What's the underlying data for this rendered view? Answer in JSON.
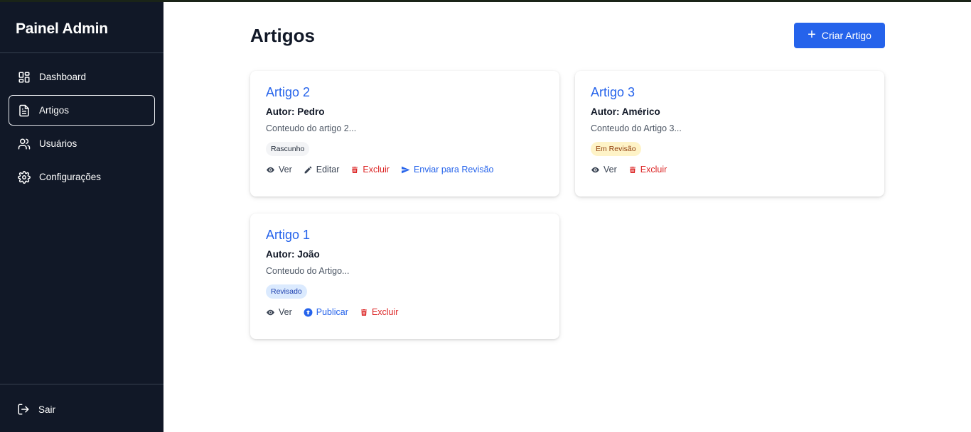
{
  "sidebar": {
    "brand": "Painel Admin",
    "items": [
      {
        "label": "Dashboard",
        "icon": "dashboard-icon"
      },
      {
        "label": "Artigos",
        "icon": "document-icon",
        "active": true
      },
      {
        "label": "Usuários",
        "icon": "users-icon"
      },
      {
        "label": "Configurações",
        "icon": "gear-icon"
      }
    ],
    "logout": "Sair"
  },
  "main": {
    "title": "Artigos",
    "create_button": "Criar Artigo",
    "articles": [
      {
        "title": "Artigo 2",
        "author": "Autor: Pedro",
        "excerpt": "Conteudo do artigo 2...",
        "status": "Rascunho",
        "status_color": "#f3f4f6",
        "actions": [
          "Ver",
          "Editar",
          "Excluir",
          "Enviar para Revisão"
        ]
      },
      {
        "title": "Artigo 3",
        "author": "Autor: Américo",
        "excerpt": "Conteudo do Artigo 3...",
        "status": "Em Revisão",
        "status_color": "#fef3c7",
        "actions": [
          "Ver",
          "Excluir"
        ]
      },
      {
        "title": "Artigo 1",
        "author": "Autor: João",
        "excerpt": "Conteudo do Artigo...",
        "status": "Revisado",
        "status_color": "#dbeafe",
        "actions": [
          "Ver",
          "Publicar",
          "Excluir"
        ]
      }
    ]
  },
  "colors": {
    "sidebar_bg": "#111827",
    "accent": "#2563eb",
    "danger": "#dc2626"
  }
}
